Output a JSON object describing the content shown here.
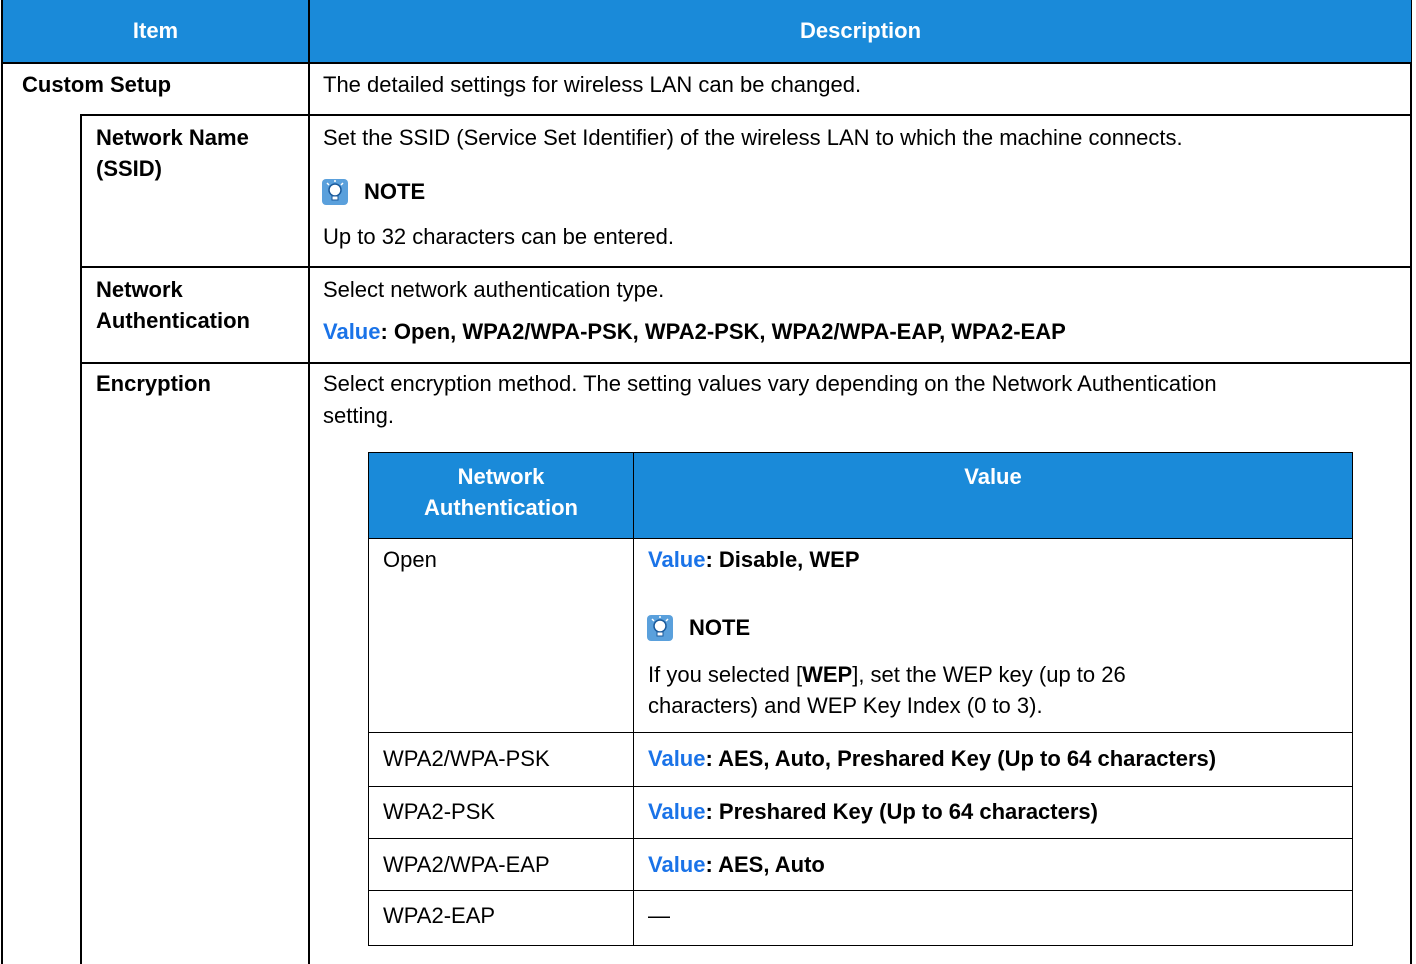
{
  "header": {
    "item": "Item",
    "description": "Description"
  },
  "rows": {
    "custom_setup": {
      "label": "Custom Setup",
      "desc": "The detailed settings for wireless LAN can be changed."
    },
    "ssid": {
      "label_line1": "Network Name",
      "label_line2": "(SSID)",
      "desc": "Set the SSID (Service Set Identifier) of the wireless LAN to which the machine connects.",
      "note_label": "NOTE",
      "note_text": "Up to 32 characters can be entered."
    },
    "auth": {
      "label_line1": "Network",
      "label_line2": "Authentication",
      "desc": "Select network authentication type.",
      "value_label": "Value",
      "value_text": ": Open, WPA2/WPA-PSK, WPA2-PSK, WPA2/WPA-EAP, WPA2-EAP"
    },
    "encryption": {
      "label": "Encryption",
      "desc_line1": "Select encryption method. The setting values vary depending on the Network Authentication",
      "desc_line2": "setting."
    }
  },
  "inner_table": {
    "header_auth_line1": "Network",
    "header_auth_line2": "Authentication",
    "header_value": "Value",
    "rows": [
      {
        "auth": "Open",
        "value_label": "Value",
        "value_text": ": Disable, WEP"
      },
      {
        "auth": "WPA2/WPA-PSK",
        "value_label": "Value",
        "value_text": ": AES, Auto, Preshared Key (Up to 64 characters)"
      },
      {
        "auth": "WPA2-PSK",
        "value_label": "Value",
        "value_text": ": Preshared Key (Up to 64 characters)"
      },
      {
        "auth": "WPA2/WPA-EAP",
        "value_label": "Value",
        "value_text": ": AES, Auto"
      },
      {
        "auth": "WPA2-EAP",
        "value_text": "—"
      }
    ],
    "open_note": {
      "note_label": "NOTE",
      "line1_pre": "If you selected [",
      "line1_bold": "WEP",
      "line1_post": "], set the WEP key (up to 26",
      "line2": "characters) and WEP Key Index (0 to 3)."
    }
  },
  "colors": {
    "header_bg": "#1a8ad9",
    "value_blue": "#1a73e8",
    "border": "#000000"
  },
  "icons": {
    "note": "lightbulb-note-icon"
  }
}
